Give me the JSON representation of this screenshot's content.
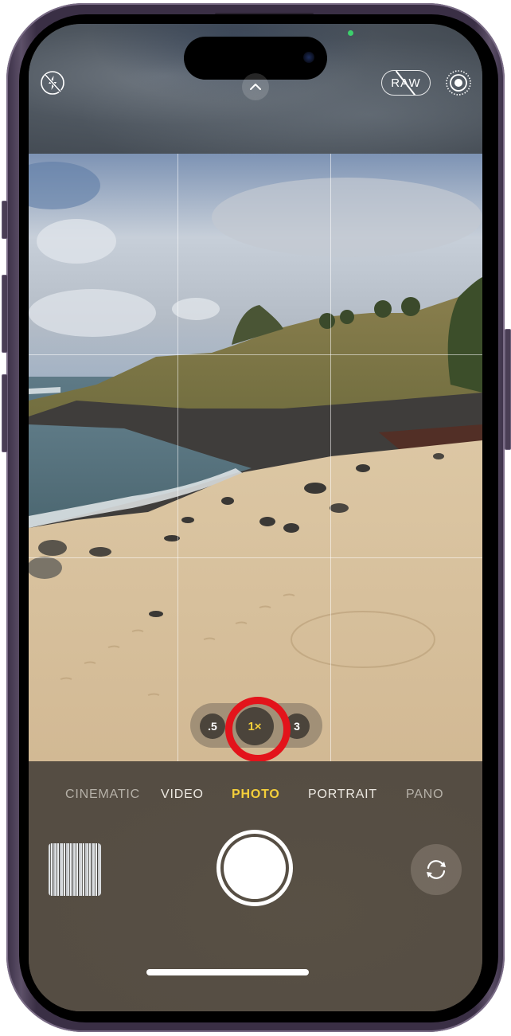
{
  "device": "iPhone",
  "app": "Camera",
  "top_controls": {
    "flash": {
      "icon": "flash-off-icon",
      "state": "off"
    },
    "controls_toggle": {
      "icon": "chevron-up-icon"
    },
    "raw": {
      "label": "RAW",
      "state": "off"
    },
    "live_photo": {
      "icon": "live-photo-icon",
      "state": "on"
    }
  },
  "privacy_indicator": {
    "color": "#3ccf6c",
    "meaning": "camera-in-use"
  },
  "viewfinder": {
    "grid": "3x3",
    "scene": "overcast sky over grassy headland, rocky shoreline, ocean waves and sandy beach with footprints"
  },
  "zoom": {
    "options": [
      {
        "label": ".5",
        "selected": false
      },
      {
        "label": "1×",
        "selected": true
      },
      {
        "label": "3",
        "selected": false
      }
    ],
    "highlight_color": "#e3131b",
    "active_color": "#f4cf3a"
  },
  "modes": {
    "items": [
      {
        "label": "CINEMATIC",
        "active": false
      },
      {
        "label": "VIDEO",
        "active": false
      },
      {
        "label": "PHOTO",
        "active": true
      },
      {
        "label": "PORTRAIT",
        "active": false
      },
      {
        "label": "PANO",
        "active": false
      }
    ]
  },
  "bottom_controls": {
    "thumbnail": {
      "icon": "last-photo-thumbnail"
    },
    "shutter": {
      "icon": "shutter-button"
    },
    "flip_camera": {
      "icon": "camera-flip-icon"
    }
  }
}
